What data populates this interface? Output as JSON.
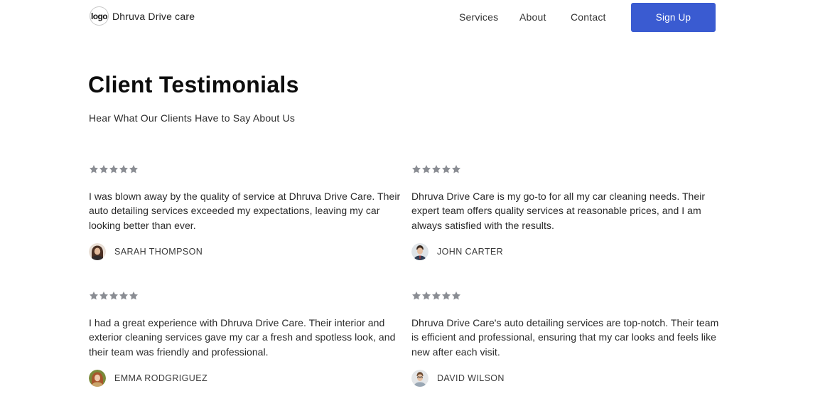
{
  "header": {
    "logo_text": "logo",
    "brand_name": "Dhruva Drive care",
    "nav": {
      "services": "Services",
      "about": "About",
      "contact": "Contact"
    },
    "signup_label": "Sign Up"
  },
  "section": {
    "title": "Client Testimonials",
    "subtitle": "Hear What Our Clients Have to Say About Us"
  },
  "colors": {
    "accent": "#3a5bd1",
    "star": "#8a8d93"
  },
  "testimonials": [
    {
      "rating": 5,
      "quote": "I was blown away by the quality of service at Dhruva Drive Care. Their auto detailing services exceeded my expectations, leaving my car looking better than ever.",
      "author": "SARAH THOMPSON"
    },
    {
      "rating": 5,
      "quote": "Dhruva Drive Care is my go-to for all my car cleaning needs. Their expert team offers quality services at reasonable prices, and I am always satisfied with the results.",
      "author": "JOHN CARTER"
    },
    {
      "rating": 5,
      "quote": "I had a great experience with Dhruva Drive Care. Their interior and exterior cleaning services gave my car a fresh and spotless look, and their team was friendly and professional.",
      "author": "EMMA RODGRIGUEZ"
    },
    {
      "rating": 5,
      "quote": "Dhruva Drive Care's auto detailing services are top-notch. Their team is efficient and professional, ensuring that my car looks and feels like new after each visit.",
      "author": "DAVID WILSON"
    }
  ]
}
